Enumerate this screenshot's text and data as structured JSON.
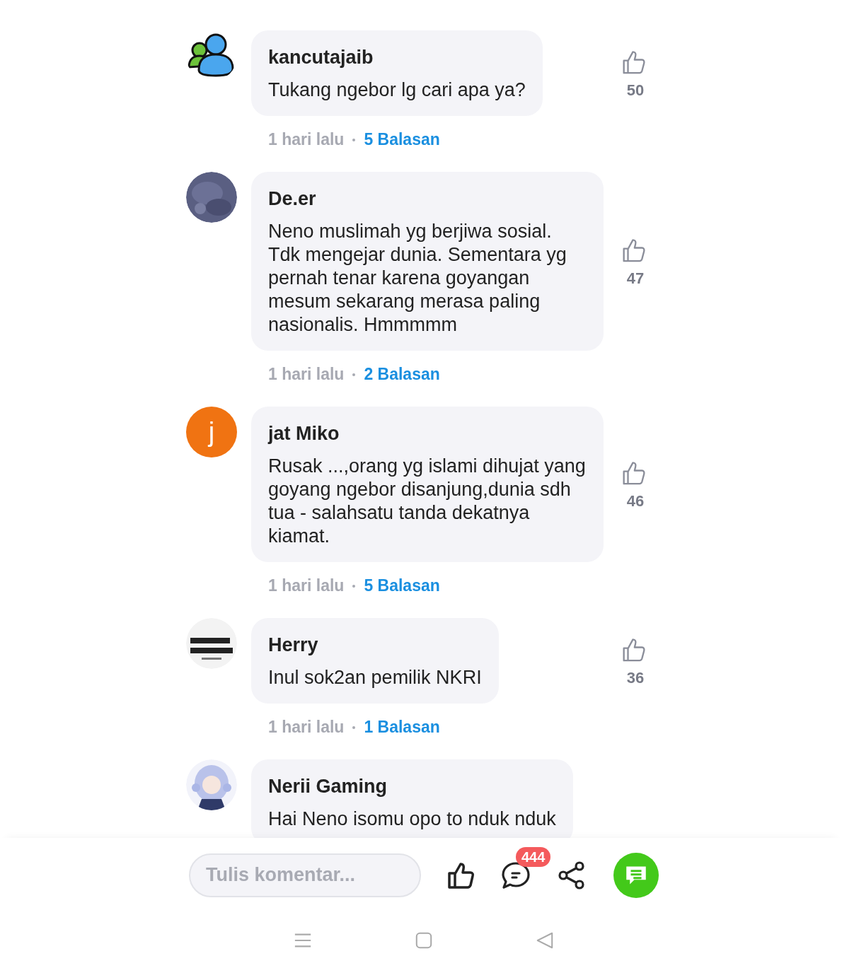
{
  "comments": [
    {
      "author": "kancutajaib",
      "avatar": {
        "kind": "people"
      },
      "text": "Tukang ngebor lg cari apa ya?",
      "likes": "50",
      "time": "1 hari lalu",
      "replies": "5 Balasan"
    },
    {
      "author": "De.er",
      "text": "Neno muslimah yg berjiwa sosial. Tdk mengejar dunia. Sementara yg pernah tenar karena goyangan mesum sekarang merasa paling nasionalis. Hmmmmm",
      "likes": "47",
      "time": "1 hari lalu",
      "replies": "2 Balasan"
    },
    {
      "author": "jat Miko",
      "avatar": {
        "kind": "letter",
        "letter": "j",
        "color": "#f07312"
      },
      "text": "Rusak ...,orang yg islami dihujat yang goyang ngebor disanjung,dunia sdh tua - salahsatu tanda dekatnya kiamat.",
      "likes": "46",
      "time": "1 hari lalu",
      "replies": "5 Balasan"
    },
    {
      "author": "Herry",
      "text": "Inul sok2an pemilik NKRI",
      "likes": "36",
      "time": "1 hari lalu",
      "replies": "1 Balasan"
    },
    {
      "author": "Nerii Gaming",
      "text": "Hai Neno isomu opo to nduk nduk"
    }
  ],
  "bottom_bar": {
    "comment_field": {
      "placeholder": "Tulis komentar..."
    },
    "comment_count": "444"
  }
}
